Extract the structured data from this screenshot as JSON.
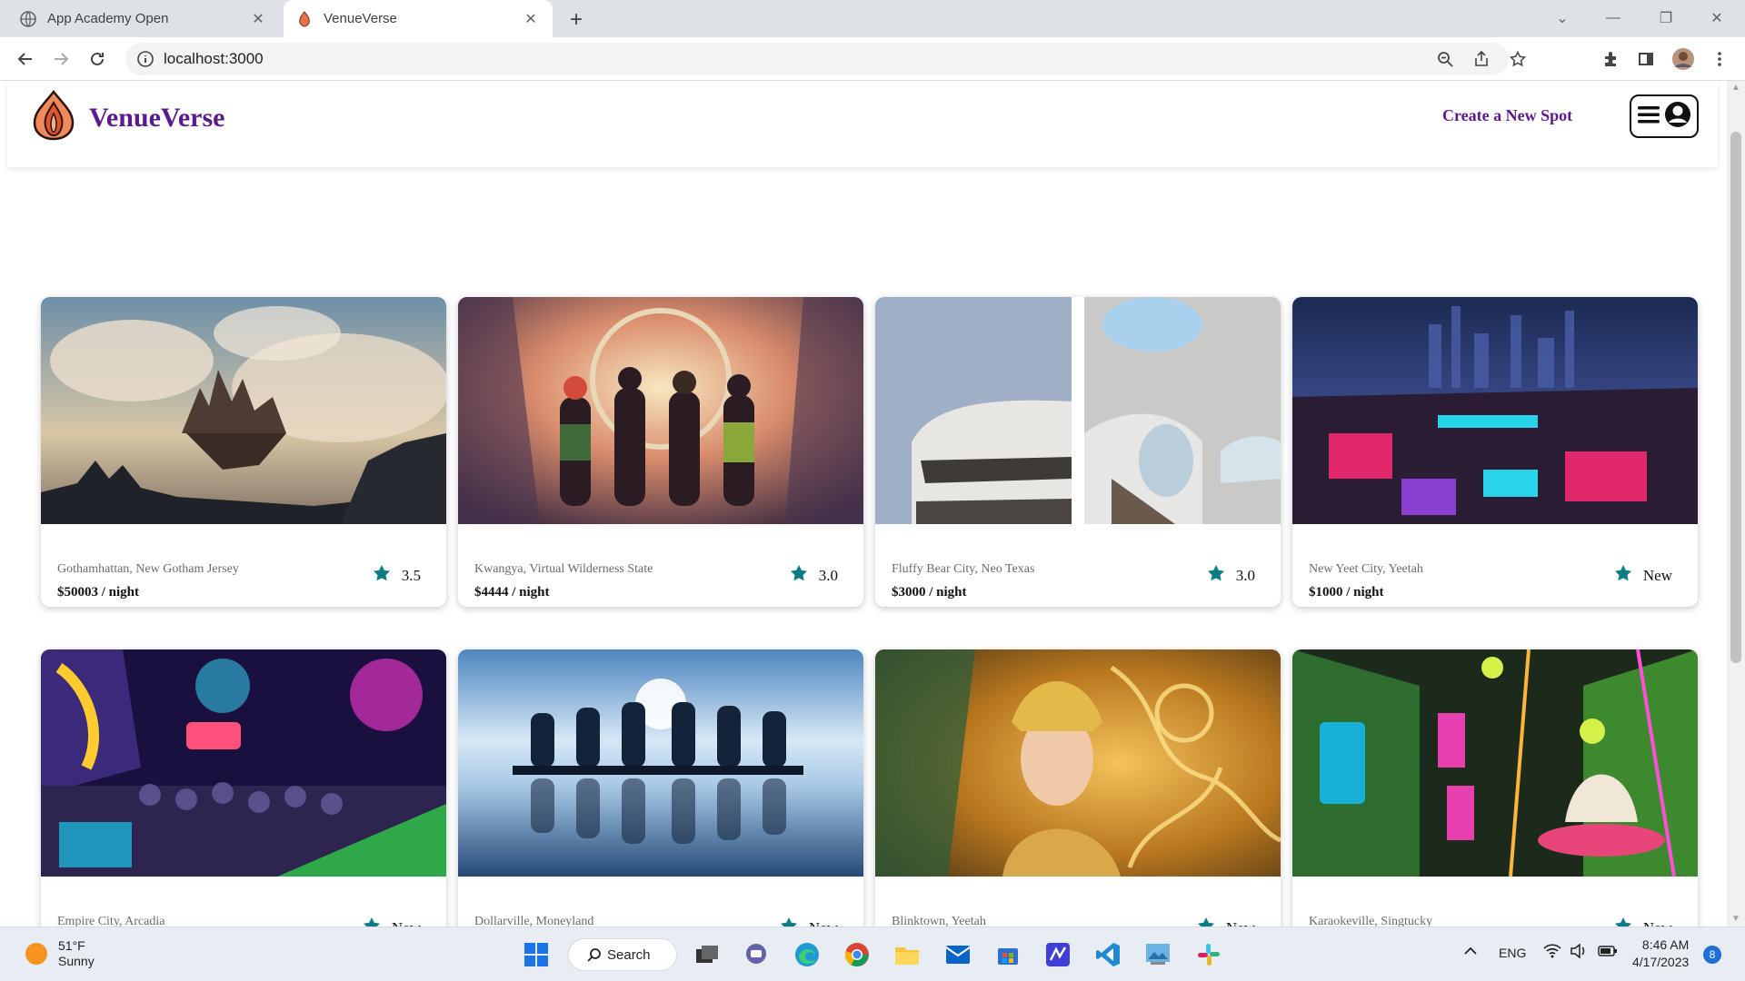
{
  "browser": {
    "tabs": [
      {
        "title": "App Academy Open",
        "active": false
      },
      {
        "title": "VenueVerse",
        "active": true
      }
    ],
    "address": "localhost:3000"
  },
  "site": {
    "brand": "VenueVerse",
    "create_spot_label": "Create a New Spot",
    "accent_color": "#5b1a8e",
    "star_color": "#0e7c86"
  },
  "spots": [
    {
      "location": "Gothamhattan, New Gotham Jersey",
      "price": "$50003",
      "unit": " / night",
      "rating": "3.5"
    },
    {
      "location": "Kwangya, Virtual Wilderness State",
      "price": "$4444",
      "unit": " / night",
      "rating": "3.0"
    },
    {
      "location": "Fluffy Bear City, Neo Texas",
      "price": "$3000",
      "unit": " / night",
      "rating": "3.0"
    },
    {
      "location": "New Yeet City, Yeetah",
      "price": "$1000",
      "unit": " / night",
      "rating": "New"
    },
    {
      "location": "Empire City, Arcadia",
      "price": "",
      "unit": "",
      "rating": "New"
    },
    {
      "location": "Dollarville, Moneyland",
      "price": "",
      "unit": "",
      "rating": "New"
    },
    {
      "location": "Blinktown, Yeetah",
      "price": "",
      "unit": "",
      "rating": "New"
    },
    {
      "location": "Karaokeville, Singtucky",
      "price": "",
      "unit": "",
      "rating": "New"
    }
  ],
  "taskbar": {
    "weather_temp": "51°F",
    "weather_desc": "Sunny",
    "search_label": "Search",
    "lang": "ENG",
    "time": "8:46 AM",
    "date": "4/17/2023",
    "notifications": "8"
  }
}
